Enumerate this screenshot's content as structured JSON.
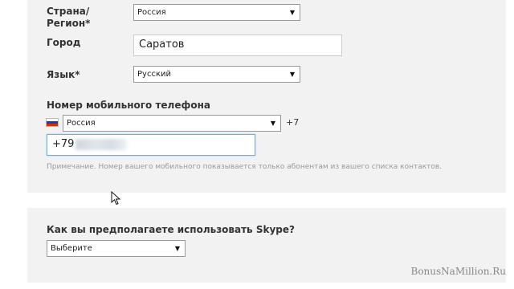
{
  "form": {
    "country_region_label_line1": "Страна/",
    "country_region_label_line2": "Регион*",
    "country_value": "Россия",
    "city_label": "Город",
    "city_value": "Саратов",
    "language_label": "Язык*",
    "language_value": "Русский",
    "mobile_label": "Номер мобильного телефона",
    "phone_country_value": "Россия",
    "phone_code": "+7",
    "phone_value": "+79",
    "note": "Примечание. Номер вашего мобильного показывается только абонентам из вашего списка контактов.",
    "usage_label": "Как вы предполагаете использовать Skype?",
    "usage_value": "Выберите"
  },
  "icons": {
    "dropdown": "chevron-down-icon",
    "flag": "russia-flag-icon",
    "cursor": "mouse-cursor-icon"
  },
  "colors": {
    "panel_bg": "#f2f2f2",
    "focus_border": "#6ab2e6",
    "note_text": "#9a9a9a"
  },
  "watermark": "BonusNaMillion.Ru"
}
